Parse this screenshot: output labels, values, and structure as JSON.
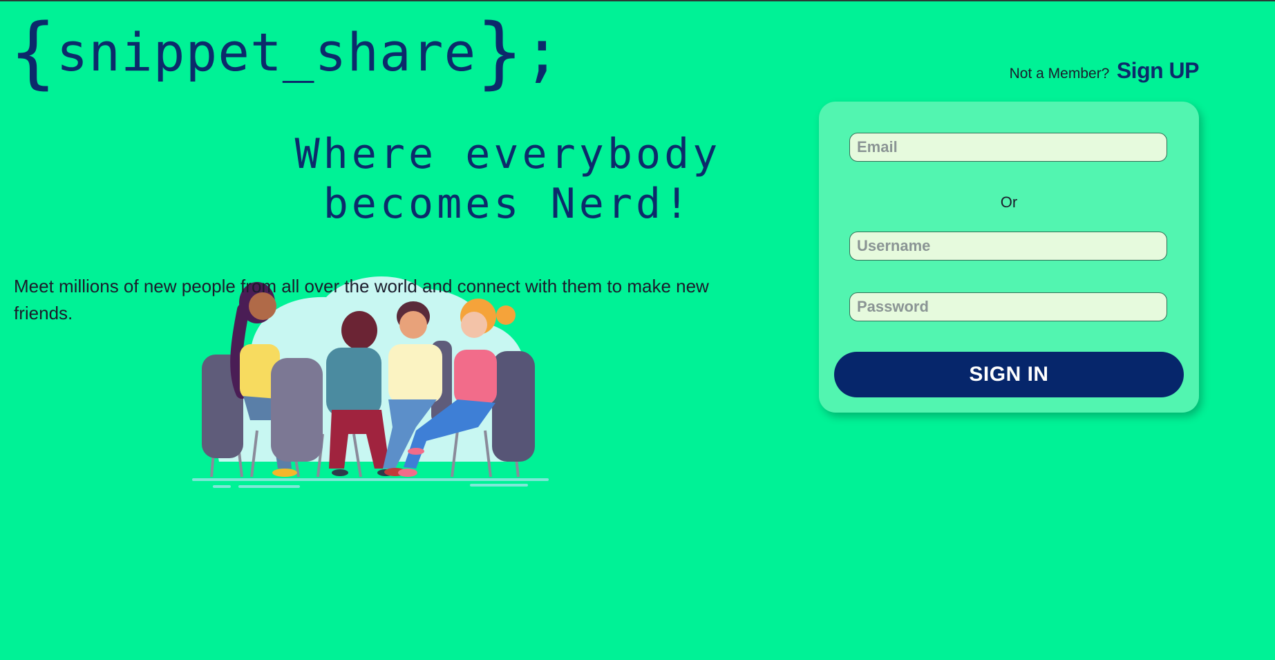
{
  "brand": {
    "open_brace": "{",
    "name": "snippet_share",
    "close_brace": "}",
    "semicolon": ";"
  },
  "hero": {
    "tagline_line1": "Where everybody",
    "tagline_line2": "becomes Nerd!",
    "description": "Meet millions of new people from all over the world and connect with them to make new friends."
  },
  "header": {
    "prompt": "Not a Member?",
    "signup_label": "Sign UP"
  },
  "login": {
    "email_placeholder": "Email",
    "or_label": "Or",
    "username_placeholder": "Username",
    "password_placeholder": "Password",
    "signin_label": "SIGN IN"
  },
  "colors": {
    "background": "#00F296",
    "card": "#52F5B0",
    "primary": "#06266B",
    "input_bg": "#E6FADD"
  },
  "illustration": {
    "icon": "friends-group-icon"
  }
}
